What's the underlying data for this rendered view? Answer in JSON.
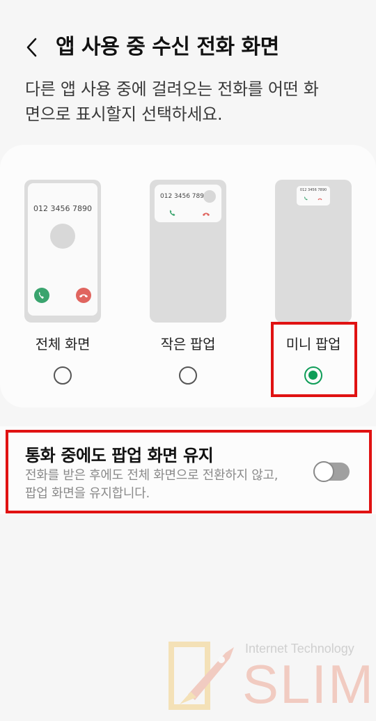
{
  "header": {
    "title": "앱 사용 중 수신 전화 화면",
    "back_icon": "chevron-left-icon"
  },
  "description": "다른 앱 사용 중에 걸려오는 전화를 어떤 화면으로 표시할지 선택하세요.",
  "options": [
    {
      "label": "전체 화면",
      "preview_number": "012 3456 7890",
      "selected": false
    },
    {
      "label": "작은 팝업",
      "preview_number": "012 3456 7890",
      "selected": false
    },
    {
      "label": "미니 팝업",
      "preview_number": "012 3456 7890",
      "selected": true
    }
  ],
  "keep_popup": {
    "title": "통화 중에도 팝업 화면 유지",
    "description": "전화를 받은 후에도 전체 화면으로 전환하지 않고, 팝업 화면을 유지합니다.",
    "enabled": false
  },
  "watermark": {
    "tagline": "Internet Technology",
    "brand": "SLIM"
  },
  "colors": {
    "accept": "#3aa46e",
    "decline": "#e0655f",
    "radio_selected": "#0f9d58",
    "highlight": "#e01212"
  }
}
